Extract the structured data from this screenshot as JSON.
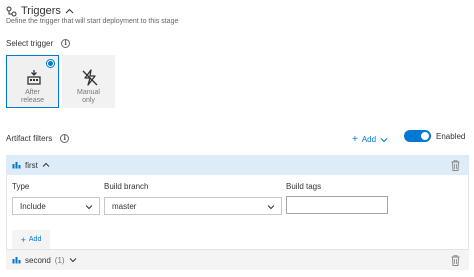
{
  "header": {
    "title": "Triggers",
    "subtitle": "Define the trigger that will start deployment to this stage"
  },
  "select_trigger": {
    "label": "Select trigger",
    "options": [
      {
        "label_line1": "After",
        "label_line2": "release",
        "icon": "after-release-icon",
        "selected": true
      },
      {
        "label_line1": "Manual",
        "label_line2": "only",
        "icon": "manual-only-icon",
        "selected": false
      }
    ]
  },
  "artifact_filters": {
    "label": "Artifact filters",
    "add_label": "Add",
    "toggle_label": "Enabled",
    "toggle_on": true,
    "accent_color": "#0078d4",
    "filters": [
      {
        "name": "first",
        "expanded": true,
        "type_label": "Type",
        "branch_label": "Build branch",
        "tags_label": "Build tags",
        "type_value": "Include",
        "branch_value": "master",
        "tags_value": "",
        "add_label": "Add"
      },
      {
        "name": "second",
        "count": "(1)",
        "expanded": false
      }
    ]
  }
}
